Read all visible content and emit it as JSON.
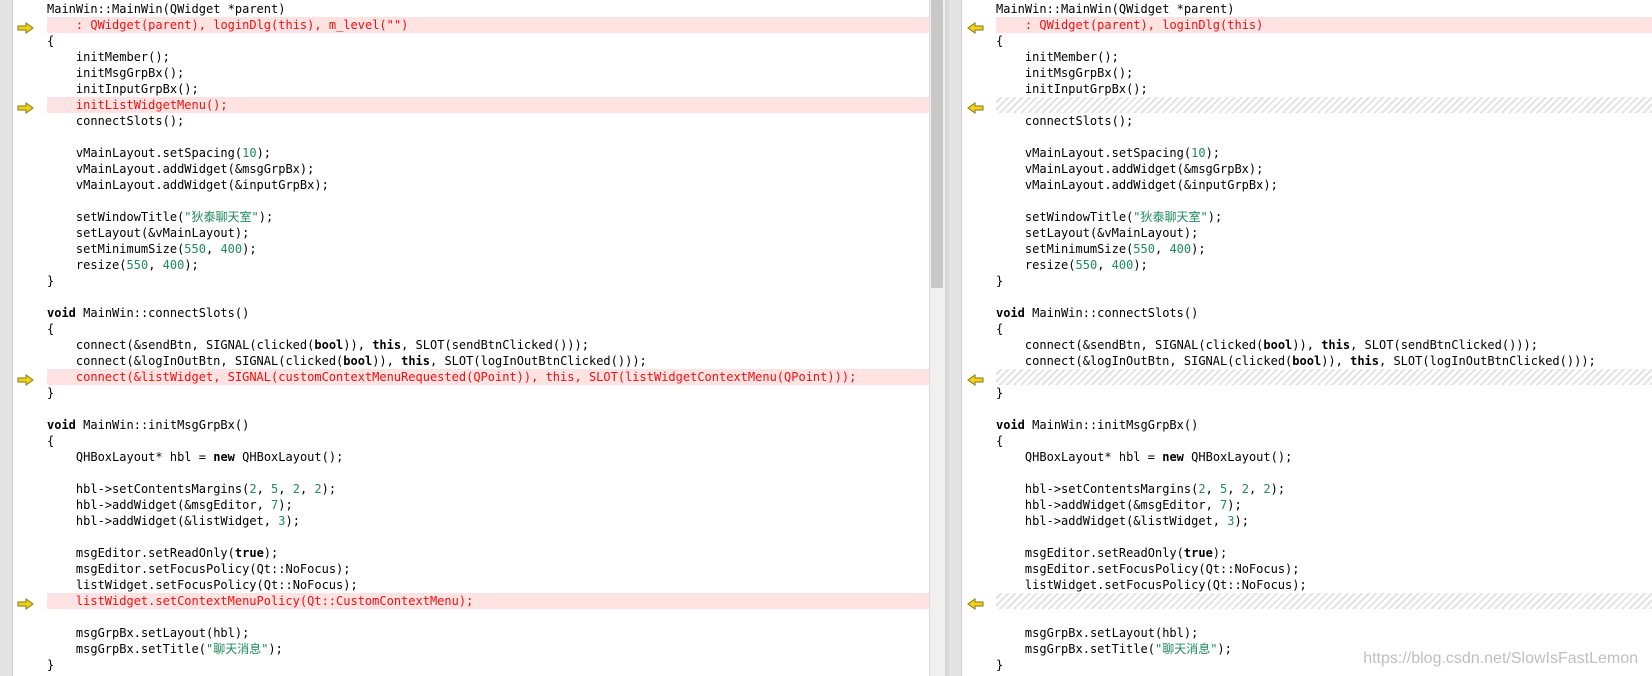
{
  "left_pane": {
    "lines": [
      {
        "t": "MainWin::MainWin(QWidget *parent)",
        "s": "normal"
      },
      {
        "t": "    : QWidget(parent), loginDlg(this), m_level(\"\")",
        "s": "changed"
      },
      {
        "t": "{",
        "s": "normal"
      },
      {
        "t": "    initMember();",
        "s": "normal"
      },
      {
        "t": "    initMsgGrpBx();",
        "s": "normal"
      },
      {
        "t": "    initInputGrpBx();",
        "s": "normal"
      },
      {
        "t": "    initListWidgetMenu();",
        "s": "changed"
      },
      {
        "t": "    connectSlots();",
        "s": "normal"
      },
      {
        "t": "",
        "s": "normal"
      },
      {
        "t": "    vMainLayout.setSpacing(10);",
        "s": "normal"
      },
      {
        "t": "    vMainLayout.addWidget(&msgGrpBx);",
        "s": "normal"
      },
      {
        "t": "    vMainLayout.addWidget(&inputGrpBx);",
        "s": "normal"
      },
      {
        "t": "",
        "s": "normal"
      },
      {
        "t": "    setWindowTitle(\"狄泰聊天室\");",
        "s": "normal"
      },
      {
        "t": "    setLayout(&vMainLayout);",
        "s": "normal"
      },
      {
        "t": "    setMinimumSize(550, 400);",
        "s": "normal"
      },
      {
        "t": "    resize(550, 400);",
        "s": "normal"
      },
      {
        "t": "}",
        "s": "normal"
      },
      {
        "t": "",
        "s": "normal"
      },
      {
        "t": "void MainWin::connectSlots()",
        "s": "normal"
      },
      {
        "t": "{",
        "s": "normal"
      },
      {
        "t": "    connect(&sendBtn, SIGNAL(clicked(bool)), this, SLOT(sendBtnClicked()));",
        "s": "normal"
      },
      {
        "t": "    connect(&logInOutBtn, SIGNAL(clicked(bool)), this, SLOT(logInOutBtnClicked()));",
        "s": "normal"
      },
      {
        "t": "    connect(&listWidget, SIGNAL(customContextMenuRequested(QPoint)), this, SLOT(listWidgetContextMenu(QPoint)));",
        "s": "changed"
      },
      {
        "t": "}",
        "s": "normal"
      },
      {
        "t": "",
        "s": "normal"
      },
      {
        "t": "void MainWin::initMsgGrpBx()",
        "s": "normal"
      },
      {
        "t": "{",
        "s": "normal"
      },
      {
        "t": "    QHBoxLayout* hbl = new QHBoxLayout();",
        "s": "normal"
      },
      {
        "t": "",
        "s": "normal"
      },
      {
        "t": "    hbl->setContentsMargins(2, 5, 2, 2);",
        "s": "normal"
      },
      {
        "t": "    hbl->addWidget(&msgEditor, 7);",
        "s": "normal"
      },
      {
        "t": "    hbl->addWidget(&listWidget, 3);",
        "s": "normal"
      },
      {
        "t": "",
        "s": "normal"
      },
      {
        "t": "    msgEditor.setReadOnly(true);",
        "s": "normal"
      },
      {
        "t": "    msgEditor.setFocusPolicy(Qt::NoFocus);",
        "s": "normal"
      },
      {
        "t": "    listWidget.setFocusPolicy(Qt::NoFocus);",
        "s": "normal"
      },
      {
        "t": "    listWidget.setContextMenuPolicy(Qt::CustomContextMenu);",
        "s": "changed"
      },
      {
        "t": "",
        "s": "normal"
      },
      {
        "t": "    msgGrpBx.setLayout(hbl);",
        "s": "normal"
      },
      {
        "t": "    msgGrpBx.setTitle(\"聊天消息\");",
        "s": "normal"
      },
      {
        "t": "}",
        "s": "normal"
      }
    ]
  },
  "right_pane": {
    "lines": [
      {
        "t": "MainWin::MainWin(QWidget *parent)",
        "s": "normal"
      },
      {
        "t": "    : QWidget(parent), loginDlg(this)",
        "s": "changed"
      },
      {
        "t": "{",
        "s": "normal"
      },
      {
        "t": "    initMember();",
        "s": "normal"
      },
      {
        "t": "    initMsgGrpBx();",
        "s": "normal"
      },
      {
        "t": "    initInputGrpBx();",
        "s": "normal"
      },
      {
        "t": "",
        "s": "hatch"
      },
      {
        "t": "    connectSlots();",
        "s": "normal"
      },
      {
        "t": "",
        "s": "normal"
      },
      {
        "t": "    vMainLayout.setSpacing(10);",
        "s": "normal"
      },
      {
        "t": "    vMainLayout.addWidget(&msgGrpBx);",
        "s": "normal"
      },
      {
        "t": "    vMainLayout.addWidget(&inputGrpBx);",
        "s": "normal"
      },
      {
        "t": "",
        "s": "normal"
      },
      {
        "t": "    setWindowTitle(\"狄泰聊天室\");",
        "s": "normal"
      },
      {
        "t": "    setLayout(&vMainLayout);",
        "s": "normal"
      },
      {
        "t": "    setMinimumSize(550, 400);",
        "s": "normal"
      },
      {
        "t": "    resize(550, 400);",
        "s": "normal"
      },
      {
        "t": "}",
        "s": "normal"
      },
      {
        "t": "",
        "s": "normal"
      },
      {
        "t": "void MainWin::connectSlots()",
        "s": "normal"
      },
      {
        "t": "{",
        "s": "normal"
      },
      {
        "t": "    connect(&sendBtn, SIGNAL(clicked(bool)), this, SLOT(sendBtnClicked()));",
        "s": "normal"
      },
      {
        "t": "    connect(&logInOutBtn, SIGNAL(clicked(bool)), this, SLOT(logInOutBtnClicked()));",
        "s": "normal"
      },
      {
        "t": "",
        "s": "hatch"
      },
      {
        "t": "}",
        "s": "normal"
      },
      {
        "t": "",
        "s": "normal"
      },
      {
        "t": "void MainWin::initMsgGrpBx()",
        "s": "normal"
      },
      {
        "t": "{",
        "s": "normal"
      },
      {
        "t": "    QHBoxLayout* hbl = new QHBoxLayout();",
        "s": "normal"
      },
      {
        "t": "",
        "s": "normal"
      },
      {
        "t": "    hbl->setContentsMargins(2, 5, 2, 2);",
        "s": "normal"
      },
      {
        "t": "    hbl->addWidget(&msgEditor, 7);",
        "s": "normal"
      },
      {
        "t": "    hbl->addWidget(&listWidget, 3);",
        "s": "normal"
      },
      {
        "t": "",
        "s": "normal"
      },
      {
        "t": "    msgEditor.setReadOnly(true);",
        "s": "normal"
      },
      {
        "t": "    msgEditor.setFocusPolicy(Qt::NoFocus);",
        "s": "normal"
      },
      {
        "t": "    listWidget.setFocusPolicy(Qt::NoFocus);",
        "s": "normal"
      },
      {
        "t": "",
        "s": "hatch"
      },
      {
        "t": "",
        "s": "normal"
      },
      {
        "t": "    msgGrpBx.setLayout(hbl);",
        "s": "normal"
      },
      {
        "t": "    msgGrpBx.setTitle(\"聊天消息\");",
        "s": "normal"
      },
      {
        "t": "}",
        "s": "normal"
      }
    ]
  },
  "keywords": [
    "void",
    "this",
    "bool",
    "new",
    "true"
  ],
  "icons": {
    "left_marker": "arrow-right-icon",
    "right_marker": "arrow-left-icon"
  },
  "colors": {
    "changed_bg": "#ffe3e3",
    "changed_text": "#ee1111",
    "number": "#1f8a5a",
    "marker": "#f2d21b"
  },
  "watermark": "https://blog.csdn.net/SlowIsFastLemon"
}
